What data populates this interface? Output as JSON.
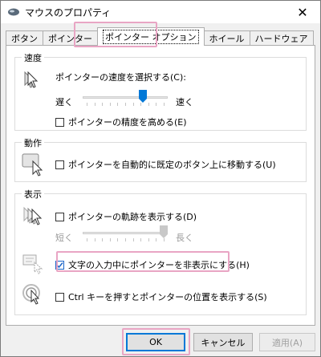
{
  "window": {
    "title": "マウスのプロパティ",
    "close_glyph": "✕"
  },
  "tabs": [
    {
      "label": "ボタン"
    },
    {
      "label": "ポインター"
    },
    {
      "label": "ポインター オプション"
    },
    {
      "label": "ホイール"
    },
    {
      "label": "ハードウェア"
    }
  ],
  "speed": {
    "title": "速度",
    "select_label": "ポインターの速度を選択する(C):",
    "slow": "遅く",
    "fast": "速く",
    "slider_value_fraction": 0.73,
    "precision": {
      "label": "ポインターの精度を高める(E)",
      "checked": false
    }
  },
  "motion": {
    "title": "動作",
    "snap": {
      "label": "ポインターを自動的に既定のボタン上に移動する(U)",
      "checked": false
    }
  },
  "visibility": {
    "title": "表示",
    "trails": {
      "label": "ポインターの軌跡を表示する(D)",
      "checked": false
    },
    "short": "短く",
    "long": "長く",
    "trail_slider_fraction": 1.0,
    "hide_while_typing": {
      "label": "文字の入力中にポインターを非表示にする(H)",
      "checked": true
    },
    "ctrl_locate": {
      "label": "Ctrl キーを押すとポインターの位置を表示する(S)",
      "checked": false
    }
  },
  "buttons": {
    "ok": "OK",
    "cancel": "キャンセル",
    "apply": "適用(A)"
  },
  "colors": {
    "highlight": "#e9a5c4",
    "accent": "#0078d7"
  }
}
